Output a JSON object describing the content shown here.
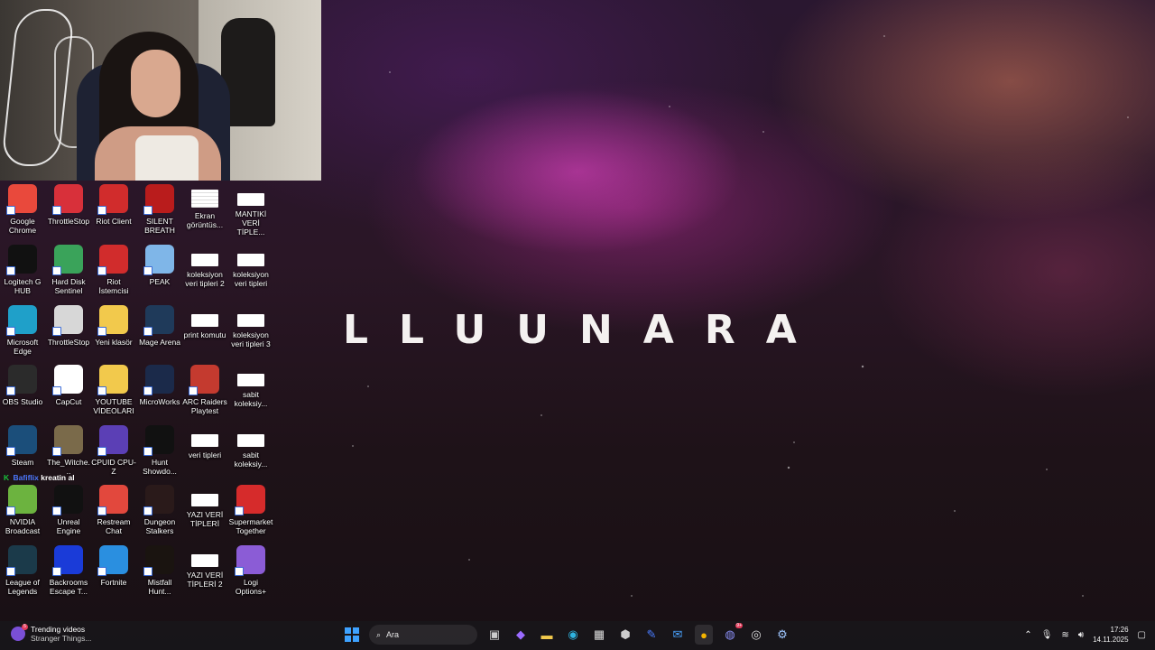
{
  "brand": {
    "logo_text": "LLUUNARA"
  },
  "chat": {
    "badge": "K",
    "user": "Bafiflix",
    "message": "kreatin al"
  },
  "desktop_icons": [
    {
      "label": "Google Chrome",
      "icon": "chrome-icon",
      "color": "#e9493c"
    },
    {
      "label": "ThrottleStop",
      "icon": "throttlestop-icon",
      "color": "#d8303a"
    },
    {
      "label": "Riot Client",
      "icon": "riot-client-icon",
      "color": "#d12c2c"
    },
    {
      "label": "SILENT BREATH",
      "icon": "silent-breath-icon",
      "color": "#b91c1c"
    },
    {
      "label": "Ekran görüntüs...",
      "icon": "screenshot-file-icon",
      "color": "#ffffff"
    },
    {
      "label": "MANTIKİ VERİ TİPLE...",
      "icon": "document-icon",
      "color": "#ffffff"
    },
    {
      "label": "Logitech G HUB",
      "icon": "logitech-ghub-icon",
      "color": "#111111"
    },
    {
      "label": "Hard Disk Sentinel",
      "icon": "hard-disk-sentinel-icon",
      "color": "#3aa35a"
    },
    {
      "label": "Riot İstemcisi",
      "icon": "riot-client-icon",
      "color": "#d12c2c"
    },
    {
      "label": "PEAK",
      "icon": "peak-icon",
      "color": "#7fb6e8"
    },
    {
      "label": "koleksiyon veri tipleri 2",
      "icon": "document-icon",
      "color": "#ffffff"
    },
    {
      "label": "koleksiyon veri tipleri",
      "icon": "document-icon",
      "color": "#ffffff"
    },
    {
      "label": "Microsoft Edge",
      "icon": "edge-icon",
      "color": "#1fa0c9"
    },
    {
      "label": "ThrottleStop",
      "icon": "settings-file-icon",
      "color": "#d7d7d7"
    },
    {
      "label": "Yeni klasör",
      "icon": "folder-icon",
      "color": "#f2c94c"
    },
    {
      "label": "Mage Arena",
      "icon": "mage-arena-icon",
      "color": "#1f3a5a"
    },
    {
      "label": "print komutu",
      "icon": "document-icon",
      "color": "#ffffff"
    },
    {
      "label": "koleksiyon veri tipleri 3",
      "icon": "document-icon",
      "color": "#ffffff"
    },
    {
      "label": "OBS Studio",
      "icon": "obs-icon",
      "color": "#2b2b2b"
    },
    {
      "label": "CapCut",
      "icon": "capcut-icon",
      "color": "#ffffff"
    },
    {
      "label": "YOUTUBE VİDEOLARI",
      "icon": "folder-icon",
      "color": "#f2c94c"
    },
    {
      "label": "MicroWorks",
      "icon": "microworks-icon",
      "color": "#1b2a4a"
    },
    {
      "label": "ARC Raiders Playtest",
      "icon": "arc-raiders-icon",
      "color": "#c43a2f"
    },
    {
      "label": "sabit koleksiy...",
      "icon": "document-icon",
      "color": "#ffffff"
    },
    {
      "label": "Steam",
      "icon": "steam-icon",
      "color": "#1b4e7a"
    },
    {
      "label": "The_Witche...",
      "icon": "witcher-icon",
      "color": "#7a6a4a"
    },
    {
      "label": "CPUID CPU-Z",
      "icon": "cpuz-icon",
      "color": "#5b3fb5"
    },
    {
      "label": "Hunt Showdo...",
      "icon": "hunt-showdown-icon",
      "color": "#111111"
    },
    {
      "label": "veri tipleri",
      "icon": "document-icon",
      "color": "#ffffff"
    },
    {
      "label": "sabit koleksiy...",
      "icon": "document-icon",
      "color": "#ffffff"
    },
    {
      "label": "NVIDIA Broadcast",
      "icon": "nvidia-broadcast-icon",
      "color": "#6cb33f"
    },
    {
      "label": "Unreal Engine",
      "icon": "unreal-engine-icon",
      "color": "#111111"
    },
    {
      "label": "Restream Chat",
      "icon": "restream-icon",
      "color": "#e2483d"
    },
    {
      "label": "Dungeon Stalkers",
      "icon": "dungeon-stalkers-icon",
      "color": "#2a1a1a"
    },
    {
      "label": "YAZI VERİ TİPLERİ",
      "icon": "document-icon",
      "color": "#ffffff"
    },
    {
      "label": "Supermarket Together",
      "icon": "supermarket-together-icon",
      "color": "#d62b2b"
    },
    {
      "label": "League of Legends",
      "icon": "league-icon",
      "color": "#1b3a4a"
    },
    {
      "label": "Backrooms Escape T...",
      "icon": "backrooms-icon",
      "color": "#1a3bd8"
    },
    {
      "label": "Fortnite",
      "icon": "fortnite-icon",
      "color": "#2a8fe0"
    },
    {
      "label": "Mistfall Hunt...",
      "icon": "mistfall-icon",
      "color": "#1a1410"
    },
    {
      "label": "YAZI VERİ TİPLERİ 2",
      "icon": "document-icon",
      "color": "#ffffff"
    },
    {
      "label": "Logi Options+",
      "icon": "logi-options-icon",
      "color": "#8b5cd6"
    }
  ],
  "taskbar": {
    "widget_title": "Trending videos",
    "widget_subtitle": "Stranger Things...",
    "widget_badge": "5",
    "search_placeholder": "Ara",
    "time": "17:26",
    "date": "14.11.2025",
    "discord_badge": "9+"
  }
}
